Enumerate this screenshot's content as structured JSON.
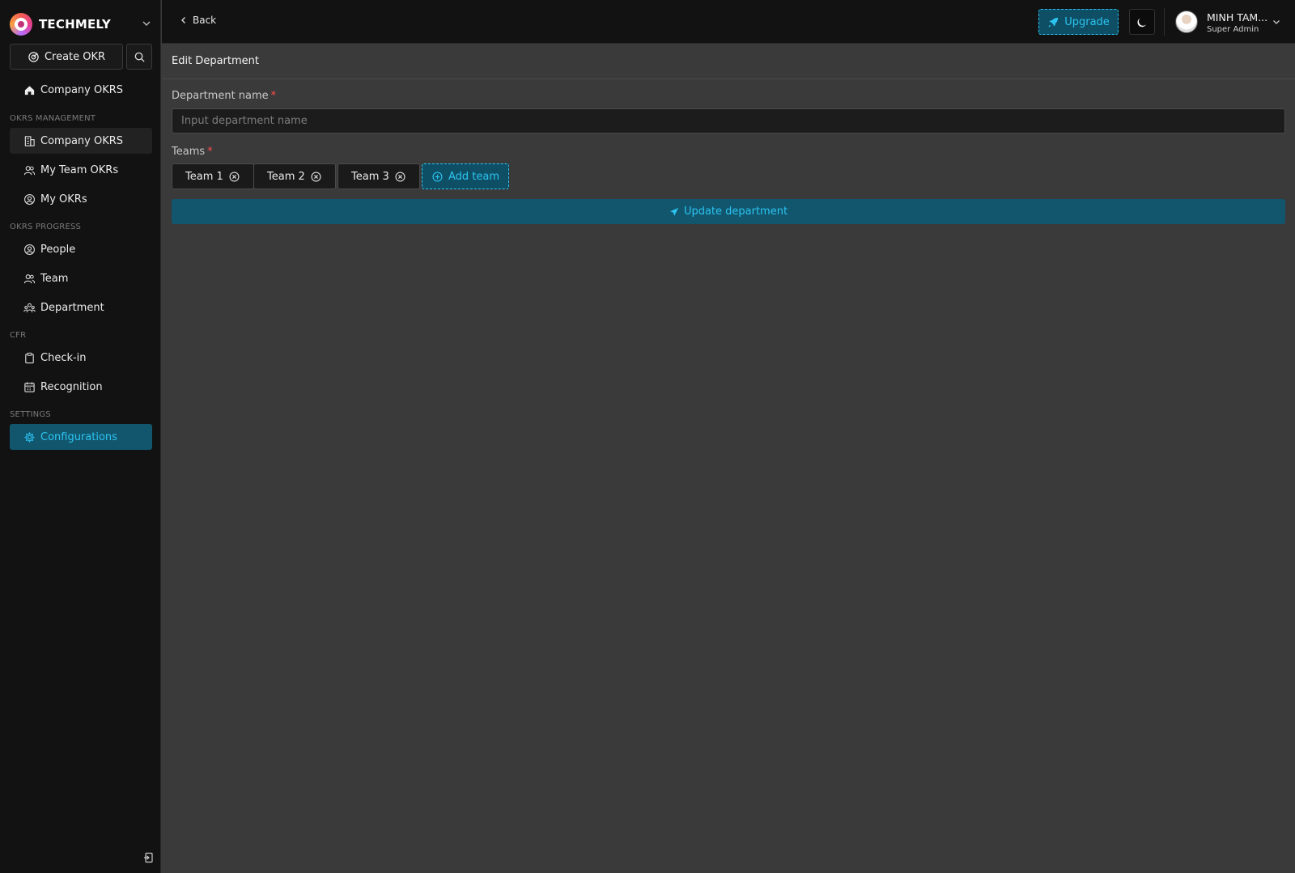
{
  "brand": {
    "name": "TECHMELY"
  },
  "sidebar": {
    "create_label": "Create OKR",
    "top_item": "Company OKRS",
    "sections": [
      {
        "title": "OKRS MANAGEMENT",
        "items": [
          "Company OKRS",
          "My Team OKRs",
          "My OKRs"
        ]
      },
      {
        "title": "OKRS PROGRESS",
        "items": [
          "People",
          "Team",
          "Department"
        ]
      },
      {
        "title": "CFR",
        "items": [
          "Check-in",
          "Recognition"
        ]
      },
      {
        "title": "SETTINGS",
        "items": [
          "Configurations"
        ]
      }
    ]
  },
  "topbar": {
    "back_label": "Back",
    "upgrade_label": "Upgrade",
    "user_name": "MINH TAM...",
    "user_role": "Super Admin"
  },
  "page": {
    "title": "Edit Department",
    "department_label": "Department name",
    "required_mark": "*",
    "department_placeholder": "Input department name",
    "teams_label": "Teams",
    "teams": [
      "Team 1",
      "Team 2",
      "Team 3"
    ],
    "add_team_label": "Add team",
    "submit_label": "Update department"
  },
  "colors": {
    "accent": "#2cc4f0",
    "accent_bg": "#12566e",
    "sidebar_bg": "#121212",
    "content_bg": "#3a3a3a",
    "required": "#ff4d4f"
  },
  "icons": [
    "logo-icon",
    "chevron-down-icon",
    "target-icon",
    "search-icon",
    "home-icon",
    "building-icon",
    "team-icon",
    "user-circle-icon",
    "department-icon",
    "clipboard-icon",
    "calendar-icon",
    "gear-icon",
    "rocket-icon",
    "moon-icon",
    "chevron-left-icon",
    "close-circle-icon",
    "plus-circle-icon",
    "send-icon",
    "collapse-icon"
  ]
}
